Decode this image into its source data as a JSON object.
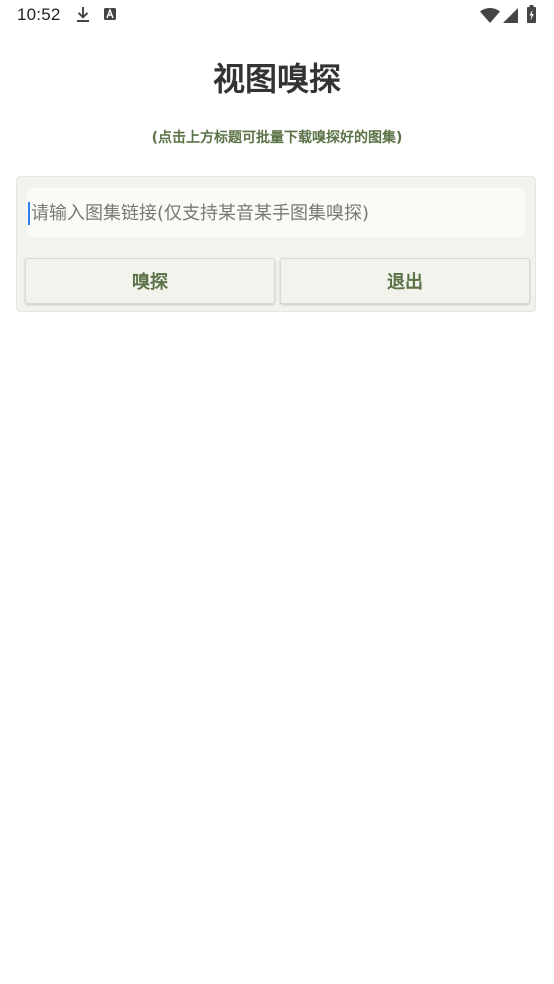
{
  "status_bar": {
    "time": "10:52",
    "left_icons": [
      "download-icon",
      "a-notification-icon"
    ],
    "right_icons": [
      "wifi-icon",
      "signal-icon",
      "battery-charging-icon"
    ]
  },
  "header": {
    "title": "视图嗅探",
    "subtitle": "(点击上方标题可批量下载嗅探好的图集)"
  },
  "form": {
    "input_value": "",
    "input_placeholder": "请输入图集链接(仅支持某音某手图集嗅探)",
    "sniff_label": "嗅探",
    "exit_label": "退出"
  },
  "colors": {
    "accent_text": "#5b7247",
    "card_background": "#f1f3ec",
    "caret": "#2d7ff0"
  }
}
